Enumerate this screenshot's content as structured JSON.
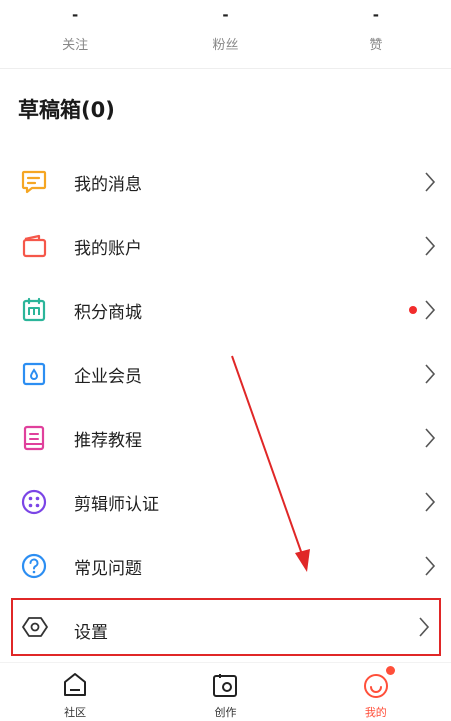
{
  "stats": [
    {
      "value": "-",
      "label": "关注"
    },
    {
      "value": "-",
      "label": "粉丝"
    },
    {
      "value": "-",
      "label": "赞"
    }
  ],
  "drafts_title": "草稿箱(0)",
  "menu": [
    {
      "label": "我的消息",
      "icon": "message-icon",
      "color": "#f5a623"
    },
    {
      "label": "我的账户",
      "icon": "wallet-icon",
      "color": "#f5574a"
    },
    {
      "label": "积分商城",
      "icon": "points-mall-icon",
      "color": "#2bb59a",
      "has_dot": true
    },
    {
      "label": "企业会员",
      "icon": "enterprise-icon",
      "color": "#2c8ef2"
    },
    {
      "label": "推荐教程",
      "icon": "book-icon",
      "color": "#e0409c"
    },
    {
      "label": "剪辑师认证",
      "icon": "certification-icon",
      "color": "#7b45e6"
    },
    {
      "label": "常见问题",
      "icon": "help-icon",
      "color": "#2c8ef2"
    }
  ],
  "settings": {
    "label": "设置",
    "icon": "settings-icon",
    "color": "#333333"
  },
  "tabs": [
    {
      "label": "社区",
      "icon": "home-icon"
    },
    {
      "label": "创作",
      "icon": "camera-icon"
    },
    {
      "label": "我的",
      "icon": "smile-icon",
      "active": true
    }
  ],
  "colors": {
    "accent": "#ff4f3a",
    "highlight_border": "#e02727",
    "badge": "#f22c2c"
  }
}
